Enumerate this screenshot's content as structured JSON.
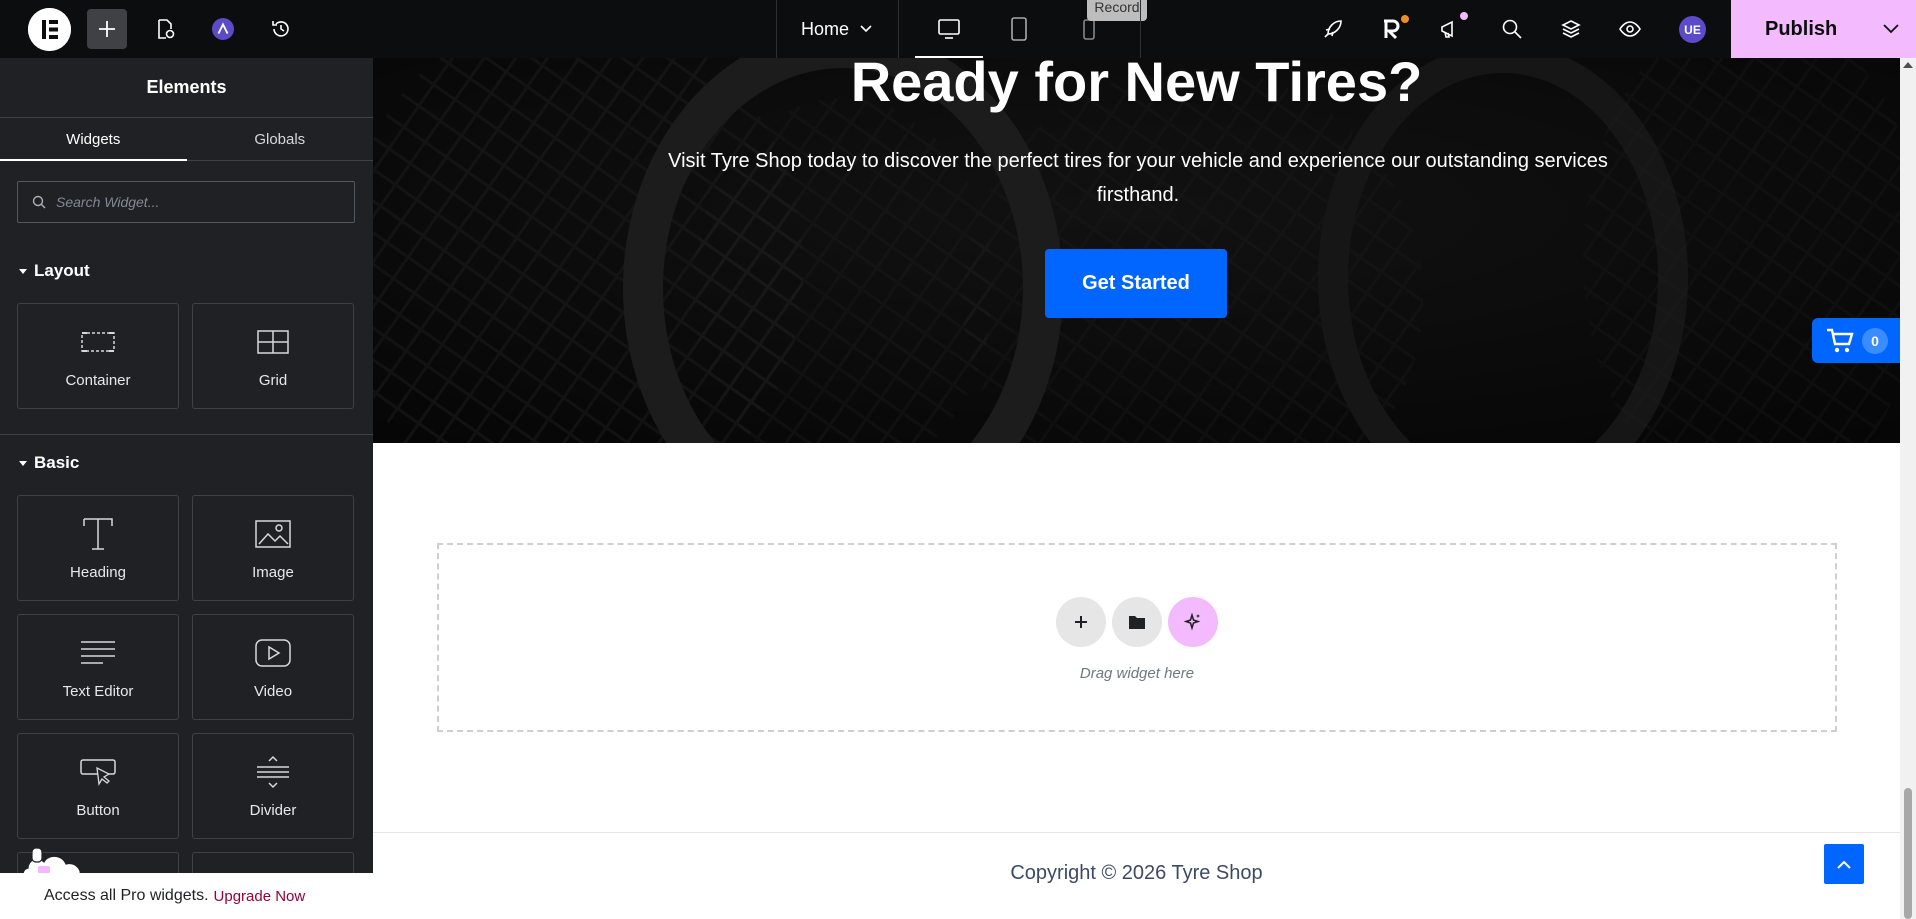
{
  "topbar": {
    "page_name": "Home",
    "record_tooltip": "Record",
    "avatar_initials": "UE",
    "publish_label": "Publish"
  },
  "panel": {
    "title": "Elements",
    "tabs": [
      "Widgets",
      "Globals"
    ],
    "search_placeholder": "Search Widget...",
    "categories": {
      "layout": {
        "title": "Layout",
        "widgets": [
          "Container",
          "Grid"
        ]
      },
      "basic": {
        "title": "Basic",
        "widgets": [
          "Heading",
          "Image",
          "Text Editor",
          "Video",
          "Button",
          "Divider"
        ]
      }
    },
    "pro_bar": {
      "text": "Access all Pro widgets.",
      "link": "Upgrade Now"
    }
  },
  "canvas": {
    "hero": {
      "title": "Ready for New Tires?",
      "text": "Visit Tyre Shop today to discover the perfect tires for your vehicle and experience our outstanding services firsthand.",
      "cta": "Get Started"
    },
    "cart_count": "0",
    "dropzone_text": "Drag widget here",
    "copyright": "Copyright © 2026 Tyre Shop"
  },
  "colors": {
    "accent_blue": "#0066ff",
    "publish_pink": "#f3bafd",
    "panel_bg": "#1f2124",
    "topbar_bg": "#0c0d0e"
  }
}
